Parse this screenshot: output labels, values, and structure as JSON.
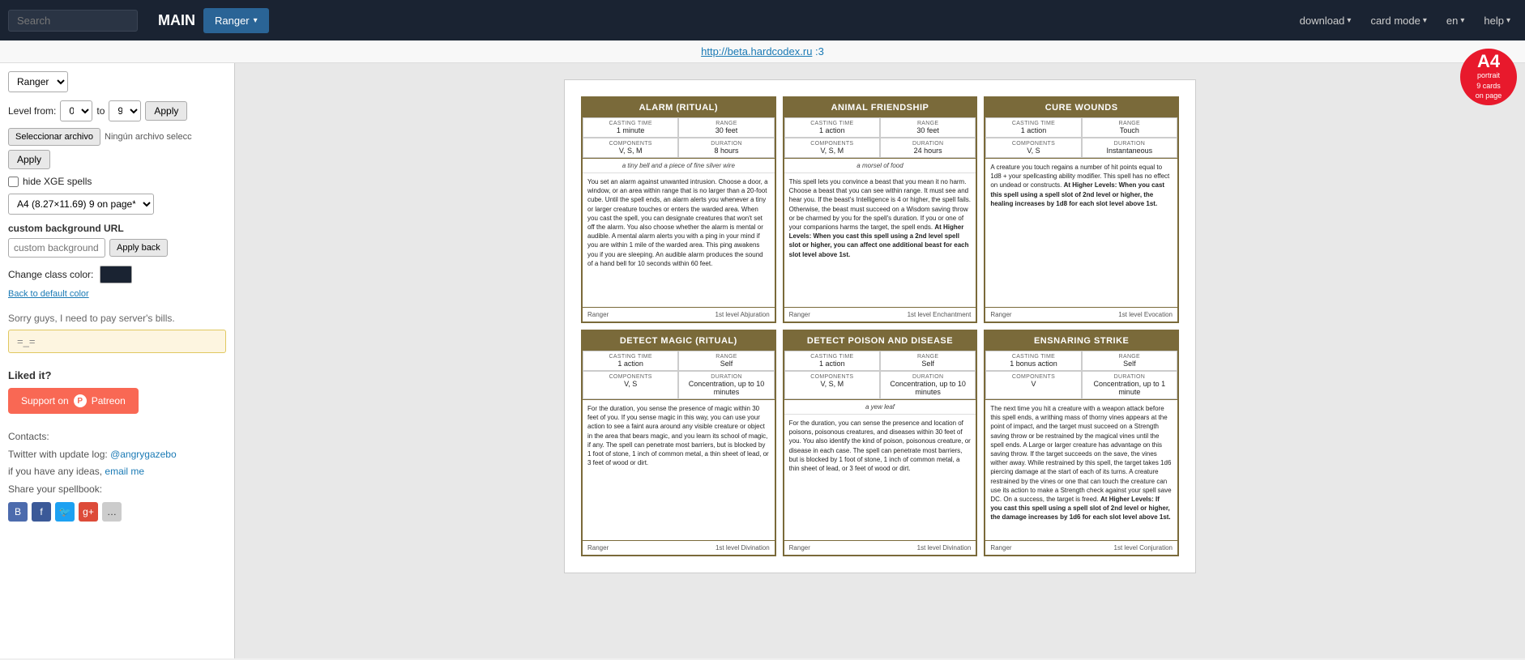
{
  "nav": {
    "search_placeholder": "Search",
    "main_label": "MAIN",
    "ranger_label": "Ranger",
    "download_label": "download",
    "card_mode_label": "card mode",
    "en_label": "en",
    "help_label": "help"
  },
  "url_bar": {
    "url": "http://beta.hardcodex.ru",
    "suffix": " :3"
  },
  "sidebar": {
    "class_select_label": "Ranger",
    "level_from_label": "Level from:",
    "level_from": "0",
    "level_to_label": "to",
    "level_to": "9",
    "apply_level_label": "Apply",
    "file_choose_label": "Seleccionar archivo",
    "file_no_file_label": "Ningún archivo selecc",
    "apply_file_label": "Apply",
    "hide_xge_label": "hide XGE spells",
    "page_size_options": [
      "A4 (8.27×11.69) 9 on page*"
    ],
    "page_size_selected": "A4 (8.27×11.69) 9 on page*",
    "bg_url_section": "custom background URL",
    "bg_url_placeholder": "custom background URL",
    "apply_back_label": "Apply back",
    "change_color_label": "Change class color:",
    "back_default_label": "Back to default color",
    "notice": "Sorry guys, I need to pay server's bills.",
    "donation_text": "=_=",
    "liked_label": "Liked it?",
    "patreon_label": "Support on",
    "patreon_platform": "Patreon",
    "contacts_label": "Contacts:",
    "twitter_label": "Twitter with update log:",
    "twitter_handle": "@angrygazebo",
    "ideas_label": "if you have any ideas,",
    "email_label": "email me",
    "share_label": "Share your spellbook:"
  },
  "a4_badge": {
    "letter": "A4",
    "line2": "portrait",
    "line3": "9 cards",
    "line4": "on page"
  },
  "cards": [
    {
      "name": "ALARM (RITUAL)",
      "casting_time_label": "CASTING TIME",
      "casting_time": "1 minute",
      "range_label": "RANGE",
      "range": "30 feet",
      "components_label": "COMPONENTS",
      "components": "V, S, M",
      "duration_label": "DURATION",
      "duration": "8 hours",
      "material": "a tiny bell and a piece of fine silver wire",
      "body": "You set an alarm against unwanted intrusion. Choose a door, a window, or an area within range that is no larger than a 20-foot cube. Until the spell ends, an alarm alerts you whenever a tiny or larger creature touches or enters the warded area. When you cast the spell, you can designate creatures that won't set off the alarm. You also choose whether the alarm is mental or audible. A mental alarm alerts you with a ping in your mind if you are within 1 mile of the warded area. This ping awakens you if you are sleeping. An audible alarm produces the sound of a hand bell for 10 seconds within 60 feet.",
      "higher_levels": "",
      "class": "Ranger",
      "level": "1st level Abjuration"
    },
    {
      "name": "ANIMAL FRIENDSHIP",
      "casting_time_label": "CASTING TIME",
      "casting_time": "1 action",
      "range_label": "RANGE",
      "range": "30 feet",
      "components_label": "COMPONENTS",
      "components": "V, S, M",
      "duration_label": "DURATION",
      "duration": "24 hours",
      "material": "a morsel of food",
      "body": "This spell lets you convince a beast that you mean it no harm. Choose a beast that you can see within range. It must see and hear you. If the beast's Intelligence is 4 or higher, the spell fails. Otherwise, the beast must succeed on a Wisdom saving throw or be charmed by you for the spell's duration. If you or one of your companions harms the target, the spell ends.",
      "higher_levels": "At Higher Levels: When you cast this spell using a 2nd level spell slot or higher, you can affect one additional beast for each slot level above 1st.",
      "class": "Ranger",
      "level": "1st level Enchantment"
    },
    {
      "name": "CURE WOUNDS",
      "casting_time_label": "CASTING TIME",
      "casting_time": "1 action",
      "range_label": "RANGE",
      "range": "Touch",
      "components_label": "COMPONENTS",
      "components": "V, S",
      "duration_label": "DURATION",
      "duration": "Instantaneous",
      "material": "",
      "body": "A creature you touch regains a number of hit points equal to 1d8 + your spellcasting ability modifier. This spell has no effect on undead or constructs.",
      "higher_levels": "At Higher Levels: When you cast this spell using a spell slot of 2nd level or higher, the healing increases by 1d8 for each slot level above 1st.",
      "class": "Ranger",
      "level": "1st level Evocation"
    },
    {
      "name": "DETECT MAGIC (RITUAL)",
      "casting_time_label": "CASTING TIME",
      "casting_time": "1 action",
      "range_label": "RANGE",
      "range": "Self",
      "components_label": "COMPONENTS",
      "components": "V, S",
      "duration_label": "DURATION",
      "duration": "Concentration, up to 10 minutes",
      "material": "",
      "body": "For the duration, you sense the presence of magic within 30 feet of you. If you sense magic in this way, you can use your action to see a faint aura around any visible creature or object in the area that bears magic, and you learn its school of magic, if any. The spell can penetrate most barriers, but is blocked by 1 foot of stone, 1 inch of common metal, a thin sheet of lead, or 3 feet of wood or dirt.",
      "higher_levels": "",
      "class": "Ranger",
      "level": "1st level Divination"
    },
    {
      "name": "DETECT POISON AND DISEASE",
      "casting_time_label": "CASTING TIME",
      "casting_time": "1 action",
      "range_label": "RANGE",
      "range": "Self",
      "components_label": "COMPONENTS",
      "components": "V, S, M",
      "duration_label": "DURATION",
      "duration": "Concentration, up to 10 minutes",
      "material": "a yew leaf",
      "body": "For the duration, you can sense the presence and location of poisons, poisonous creatures, and diseases within 30 feet of you. You also identify the kind of poison, poisonous creature, or disease in each case. The spell can penetrate most barriers, but is blocked by 1 foot of stone, 1 inch of common metal, a thin sheet of lead, or 3 feet of wood or dirt.",
      "higher_levels": "",
      "class": "Ranger",
      "level": "1st level Divination"
    },
    {
      "name": "ENSNARING STRIKE",
      "casting_time_label": "CASTING TIME",
      "casting_time": "1 bonus action",
      "range_label": "RANGE",
      "range": "Self",
      "components_label": "COMPONENTS",
      "components": "V",
      "duration_label": "DURATION",
      "duration": "Concentration, up to 1 minute",
      "material": "",
      "body": "The next time you hit a creature with a weapon attack before this spell ends, a writhing mass of thorny vines appears at the point of impact, and the target must succeed on a Strength saving throw or be restrained by the magical vines until the spell ends. A Large or larger creature has advantage on this saving throw. If the target succeeds on the save, the vines wither away. While restrained by this spell, the target takes 1d6 piercing damage at the start of each of its turns. A creature restrained by the vines or one that can touch the creature can use its action to make a Strength check against your spell save DC. On a success, the target is freed.",
      "higher_levels": "At Higher Levels: If you cast this spell using a spell slot of 2nd level or higher, the damage increases by 1d6 for each slot level above 1st.",
      "class": "Ranger",
      "level": "1st level Conjuration"
    }
  ]
}
